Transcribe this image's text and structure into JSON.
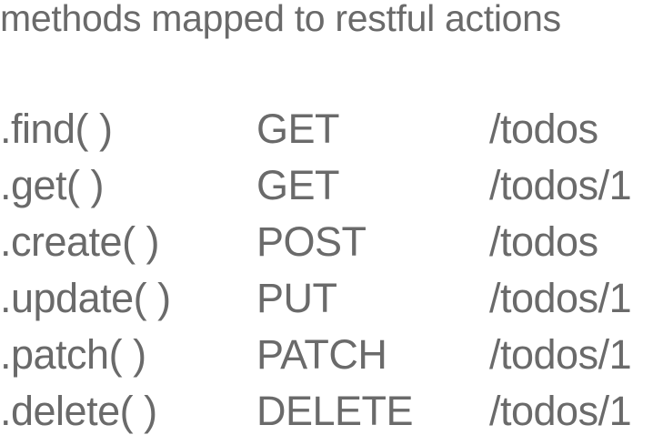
{
  "slide": {
    "title": "methods mapped to restful actions",
    "rows": [
      {
        "method": ".find( )",
        "http": "GET",
        "path": "/todos"
      },
      {
        "method": ".get( )",
        "http": "GET",
        "path": "/todos/1"
      },
      {
        "method": ".create( )",
        "http": "POST",
        "path": "/todos"
      },
      {
        "method": ".update( )",
        "http": "PUT",
        "path": "/todos/1"
      },
      {
        "method": ".patch( )",
        "http": "PATCH",
        "path": "/todos/1"
      },
      {
        "method": ".delete( )",
        "http": "DELETE",
        "path": "/todos/1"
      }
    ]
  },
  "colors": {
    "text": "#6a6a6a",
    "background": "#ffffff"
  }
}
